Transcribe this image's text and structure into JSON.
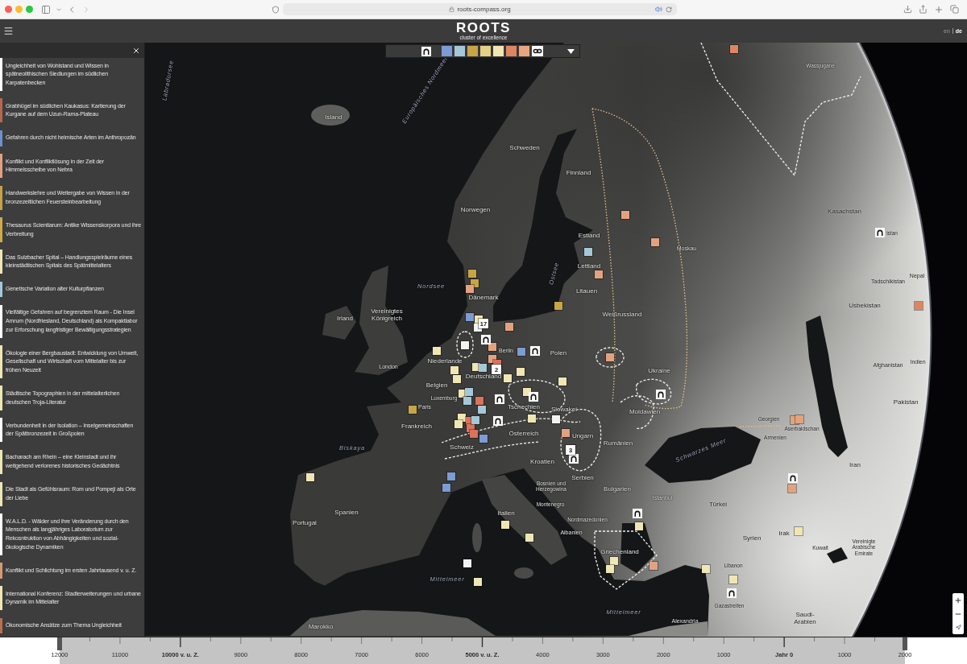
{
  "browser": {
    "url": "roots-compass.org"
  },
  "header": {
    "logo": "ROOTS",
    "tagline": "cluster of excellence",
    "languages": [
      {
        "label": "en",
        "selected": false
      },
      {
        "label": "de",
        "selected": true
      }
    ]
  },
  "filter_bar": {
    "swatches": [
      {
        "color": "#7d9bd4"
      },
      {
        "color": "#a4c8d8"
      },
      {
        "color": "#c7a445"
      },
      {
        "color": "#e3cf86"
      },
      {
        "color": "#efe6b4"
      },
      {
        "color": "#de8660"
      },
      {
        "color": "#e9a57f"
      }
    ]
  },
  "sidebar": {
    "items": [
      {
        "title": "Ungleichheit von Wohlstand und Wissen in spätneolithischen Siedlungen im südlichen Karpatenbecken",
        "color": "#ffffff"
      },
      {
        "title": "Grabhügel im südlichen Kaukasus: Kartierung der Kurgane auf dem Uzun-Rama-Plateau",
        "color": "#b5684b"
      },
      {
        "title": "Gefahren durch nicht heimische Arten im Anthropozän",
        "color": "#6f8fcf"
      },
      {
        "title": "Konflikt und Konfliktlösung in der Zeit der Himmelsscheibe von Nebra",
        "color": "#e3a080"
      },
      {
        "title": "Handwerkslehre und Weitergabe von Wissen in der bronzezeitlichen Feuersteinbearbeitung",
        "color": "#c7a24a"
      },
      {
        "title": "Thesaurus Scientiarum: Antike Wissenskorpora und ihre Verbreitung",
        "color": "#cfa94c"
      },
      {
        "title": "Das Sulzbacher Spital – Handlungsspielräume eines kleinstädtischen Spitals des Spätmittelalters",
        "color": "#efe6b4"
      },
      {
        "title": "Genetische Variation alter Kulturpflanzen",
        "color": "#a4c8d8"
      },
      {
        "title": "Vielfältige Gefahren auf begrenztem Raum - Die Insel Amrum (Nordfriesland, Deutschland) als Kompaktlabor zur Erforschung langfristiger Bewältigungsstrategien",
        "color": "#ffffff"
      },
      {
        "title": "Ökologie einer Bergbaustadt: Entwicklung von Umwelt, Gesellschaft und Wirtschaft vom Mittelalter bis zur frühen Neuzeit",
        "color": "#efe6b4"
      },
      {
        "title": "Städtische Topographien in der mittelalterlichen deutschen Troja-Literatur",
        "color": "#efe6b4"
      },
      {
        "title": "Verbundenheit in der Isolation – Inselgemeinschaften der Spätbronzezeit in Großpolen",
        "color": "#ffffff"
      },
      {
        "title": "Bacharach am Rhein – eine Kleinstadt und ihr weitgehend verlorenes historisches Gedächtnis",
        "color": "#efe6b4"
      },
      {
        "title": "Die Stadt als Gefühlsraum: Rom und Pompeji als Orte der Liebe",
        "color": "#efe6b4"
      },
      {
        "title": "W.A.L.D. - Wälder und ihre Veränderung durch den Menschen als langjähriges Laboratorium zur Rekosntruktion von Abhängigkeiten und sozial-ökologische Dynamiken",
        "color": "#ffffff"
      },
      {
        "title": "Konflikt und Schlichtung im ersten Jahrtausend v. u. Z.",
        "color": "#d79a6e"
      },
      {
        "title": "International Konferenz: Stadterweiterungen und urbane Dynamik im Mittelalter",
        "color": "#efe6b4"
      },
      {
        "title": "Ökonomische Ansätze zum Thema Ungleichheit",
        "color": "#b86f52"
      }
    ]
  },
  "map": {
    "labels": [
      {
        "text": "Labradorsee",
        "kind": "sea"
      },
      {
        "text": "Europäisches Nordmeer",
        "kind": "sea"
      },
      {
        "text": "Wassjugane",
        "kind": "region"
      },
      {
        "text": "Island",
        "kind": "country"
      },
      {
        "text": "Schweden",
        "kind": "country"
      },
      {
        "text": "Finnland",
        "kind": "country"
      },
      {
        "text": "Norwegen",
        "kind": "country"
      },
      {
        "text": "Kasachstan",
        "kind": "country"
      },
      {
        "text": "istan",
        "kind": "region"
      },
      {
        "text": "Estland",
        "kind": "country"
      },
      {
        "text": "Moskau",
        "kind": "city"
      },
      {
        "text": "Lettland",
        "kind": "country"
      },
      {
        "text": "Tadschikistan",
        "kind": "country"
      },
      {
        "text": "Nepal",
        "kind": "country"
      },
      {
        "text": "Nordsee",
        "kind": "sea"
      },
      {
        "text": "Ostsee",
        "kind": "sea"
      },
      {
        "text": "Litauen",
        "kind": "country"
      },
      {
        "text": "Dänemark",
        "kind": "country"
      },
      {
        "text": "Usbekistan",
        "kind": "country"
      },
      {
        "text": "Vereinigtes Königreich",
        "kind": "country"
      },
      {
        "text": "Weißrussland",
        "kind": "country"
      },
      {
        "text": "Irland",
        "kind": "country"
      },
      {
        "text": "Berlin",
        "kind": "city"
      },
      {
        "text": "Polen",
        "kind": "country"
      },
      {
        "text": "Niederlande",
        "kind": "country"
      },
      {
        "text": "London",
        "kind": "city"
      },
      {
        "text": "Afghanistan",
        "kind": "country"
      },
      {
        "text": "Indien",
        "kind": "country"
      },
      {
        "text": "Ukraine",
        "kind": "country"
      },
      {
        "text": "Deutschland",
        "kind": "country"
      },
      {
        "text": "Belgien",
        "kind": "country"
      },
      {
        "text": "Luxemburg",
        "kind": "country"
      },
      {
        "text": "Tschechien",
        "kind": "country"
      },
      {
        "text": "Pakistan",
        "kind": "country"
      },
      {
        "text": "Paris",
        "kind": "city"
      },
      {
        "text": "Slowakei",
        "kind": "country"
      },
      {
        "text": "Moldawien",
        "kind": "country"
      },
      {
        "text": "Georgien",
        "kind": "country"
      },
      {
        "text": "Aserbaidschan",
        "kind": "country"
      },
      {
        "text": "Frankreich",
        "kind": "country"
      },
      {
        "text": "Österreich",
        "kind": "country"
      },
      {
        "text": "Ungarn",
        "kind": "country"
      },
      {
        "text": "Armenien",
        "kind": "country"
      },
      {
        "text": "Rumänien",
        "kind": "country"
      },
      {
        "text": "Schweiz",
        "kind": "country"
      },
      {
        "text": "Biskaya",
        "kind": "sea"
      },
      {
        "text": "Schwarzes Meer",
        "kind": "sea"
      },
      {
        "text": "Kroatien",
        "kind": "country"
      },
      {
        "text": "Iran",
        "kind": "country"
      },
      {
        "text": "Serbien",
        "kind": "country"
      },
      {
        "text": "Bosnien und Herzegowina",
        "kind": "country"
      },
      {
        "text": "Bulgarien",
        "kind": "country"
      },
      {
        "text": "Istanbul",
        "kind": "city"
      },
      {
        "text": "Montenegro",
        "kind": "country"
      },
      {
        "text": "Türkei",
        "kind": "country"
      },
      {
        "text": "Spanien",
        "kind": "country"
      },
      {
        "text": "Italien",
        "kind": "country"
      },
      {
        "text": "Portugal",
        "kind": "country"
      },
      {
        "text": "Nordmazedonien",
        "kind": "country"
      },
      {
        "text": "Albanien",
        "kind": "country"
      },
      {
        "text": "Syrien",
        "kind": "country"
      },
      {
        "text": "Irak",
        "kind": "country"
      },
      {
        "text": "Griechenland",
        "kind": "country"
      },
      {
        "text": "Kuwait",
        "kind": "country"
      },
      {
        "text": "Vereinigte Arabische Emirate",
        "kind": "country"
      },
      {
        "text": "Libanon",
        "kind": "city"
      },
      {
        "text": "Mittelmeer",
        "kind": "sea"
      },
      {
        "text": "Gazastreifen",
        "kind": "city"
      },
      {
        "text": "Mittelmeer",
        "kind": "sea"
      },
      {
        "text": "Marokko",
        "kind": "country"
      },
      {
        "text": "Alexandria",
        "kind": "city"
      },
      {
        "text": "Saudi-Arabien",
        "kind": "country"
      }
    ],
    "markers": [
      {
        "kind": "square",
        "color": "#de8660"
      },
      {
        "kind": "square",
        "color": "#e3a27f"
      },
      {
        "kind": "square",
        "color": "#e3a27f"
      },
      {
        "kind": "square",
        "color": "#a4c8d8"
      },
      {
        "kind": "square",
        "color": "#e3a27f"
      },
      {
        "kind": "square",
        "color": "#c7a445"
      },
      {
        "kind": "square",
        "color": "#c7a445"
      },
      {
        "kind": "square",
        "color": "#e3a27f"
      },
      {
        "kind": "square",
        "color": "#c7a445"
      },
      {
        "kind": "square",
        "color": "#7d9bd4"
      },
      {
        "kind": "square",
        "color": "#efe6b4"
      },
      {
        "kind": "square",
        "color": "#f2f2f2"
      },
      {
        "kind": "cluster",
        "count": "17"
      },
      {
        "kind": "square",
        "color": "#e3a27f"
      },
      {
        "kind": "square",
        "color": "#f2f2f2"
      },
      {
        "kind": "icon"
      },
      {
        "kind": "square",
        "color": "#e3a27f"
      },
      {
        "kind": "square",
        "color": "#7d9bd4"
      },
      {
        "kind": "icon"
      },
      {
        "kind": "square",
        "color": "#e3a27f"
      },
      {
        "kind": "square",
        "color": "#d9735a"
      },
      {
        "kind": "cluster",
        "count": "2"
      },
      {
        "kind": "square",
        "color": "#efe6b4"
      },
      {
        "kind": "square",
        "color": "#a4c8d8"
      },
      {
        "kind": "square",
        "color": "#efe6b4"
      },
      {
        "kind": "square",
        "color": "#efe6b4"
      },
      {
        "kind": "square",
        "color": "#efe6b4"
      },
      {
        "kind": "square",
        "color": "#efe6b4"
      },
      {
        "kind": "square",
        "color": "#efe6b4"
      },
      {
        "kind": "square",
        "color": "#efe6b4"
      },
      {
        "kind": "square",
        "color": "#e3a27f"
      },
      {
        "kind": "square",
        "color": "#efe6b4"
      },
      {
        "kind": "square",
        "color": "#a4c8d8"
      },
      {
        "kind": "square",
        "color": "#a4c8d8"
      },
      {
        "kind": "square",
        "color": "#d9735a"
      },
      {
        "kind": "square",
        "color": "#a4c8d8"
      },
      {
        "kind": "square",
        "color": "#c7a445"
      },
      {
        "kind": "icon"
      },
      {
        "kind": "icon"
      },
      {
        "kind": "square",
        "color": "#efe6b4"
      },
      {
        "kind": "icon"
      },
      {
        "kind": "square",
        "color": "#efe6b4"
      },
      {
        "kind": "square",
        "color": "#f2f2f2"
      },
      {
        "kind": "square",
        "color": "#efe6b4"
      },
      {
        "kind": "square",
        "color": "#efe6b4"
      },
      {
        "kind": "square",
        "color": "#d9735a"
      },
      {
        "kind": "square",
        "color": "#d9735a"
      },
      {
        "kind": "square",
        "color": "#d9735a"
      },
      {
        "kind": "square",
        "color": "#a4c8d8"
      },
      {
        "kind": "square",
        "color": "#7d9bd4"
      },
      {
        "kind": "square",
        "color": "#e3a27f"
      },
      {
        "kind": "cluster",
        "count": "3"
      },
      {
        "kind": "icon"
      },
      {
        "kind": "square",
        "color": "#efe6b4"
      },
      {
        "kind": "square",
        "color": "#7d9bd4"
      },
      {
        "kind": "square",
        "color": "#7d9bd4"
      },
      {
        "kind": "square",
        "color": "#efe6b4"
      },
      {
        "kind": "square",
        "color": "#efe6b4"
      },
      {
        "kind": "square",
        "color": "#f2f2f2"
      },
      {
        "kind": "square",
        "color": "#efe6b4"
      },
      {
        "kind": "icon"
      },
      {
        "kind": "icon"
      },
      {
        "kind": "square",
        "color": "#de8660"
      },
      {
        "kind": "square",
        "color": "#e3a27f"
      },
      {
        "kind": "square",
        "color": "#e3a27f"
      },
      {
        "kind": "icon"
      },
      {
        "kind": "square",
        "color": "#e3a27f"
      },
      {
        "kind": "square",
        "color": "#efe6b4"
      },
      {
        "kind": "icon"
      },
      {
        "kind": "square",
        "color": "#efe6b4"
      },
      {
        "kind": "square",
        "color": "#efe6b4"
      },
      {
        "kind": "square",
        "color": "#efe6b4"
      },
      {
        "kind": "square",
        "color": "#e3a27f"
      },
      {
        "kind": "square",
        "color": "#efe6b4"
      },
      {
        "kind": "square",
        "color": "#efe6b4"
      },
      {
        "kind": "icon"
      }
    ]
  },
  "timeline": {
    "labels": [
      {
        "text": "12000",
        "major": false
      },
      {
        "text": "11000",
        "major": false
      },
      {
        "text": "10000 v. u. Z.",
        "major": true
      },
      {
        "text": "9000",
        "major": false
      },
      {
        "text": "8000",
        "major": false
      },
      {
        "text": "7000",
        "major": false
      },
      {
        "text": "6000",
        "major": false
      },
      {
        "text": "5000 v. u. Z.",
        "major": true
      },
      {
        "text": "4000",
        "major": false
      },
      {
        "text": "3000",
        "major": false
      },
      {
        "text": "2000",
        "major": false
      },
      {
        "text": "1000",
        "major": false
      },
      {
        "text": "Jahr 0",
        "major": true
      },
      {
        "text": "1000",
        "major": false
      },
      {
        "text": "2000",
        "major": false
      }
    ]
  }
}
